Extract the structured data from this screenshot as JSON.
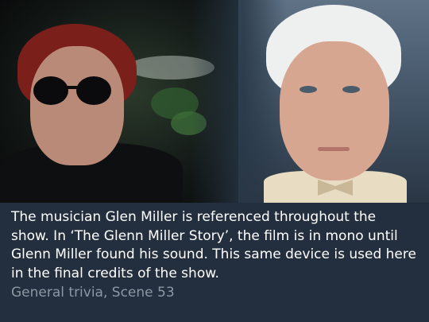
{
  "trivia": {
    "text": "The musician Glen Miller is referenced throughout the show. In ‘The Glenn Miller Story’, the film is in mono until Glenn Miller found his sound. This same device is used here in the final credits of the show.",
    "source": "General trivia, Scene 53"
  },
  "colors": {
    "background": "#232f3e",
    "text": "#ffffff",
    "source_text": "#8d97a3"
  }
}
